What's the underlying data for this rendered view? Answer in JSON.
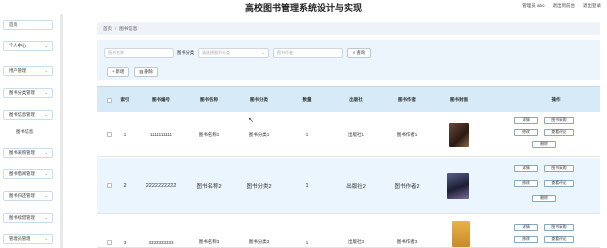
{
  "header": {
    "title": "高校图书管理系统设计与实现",
    "links": [
      "管理员 abo",
      "退出到前台",
      "退出登录"
    ]
  },
  "sidebar": {
    "items": [
      {
        "label": "首页",
        "expandable": false
      },
      {
        "label": "个人中心",
        "expandable": true
      },
      {
        "label": "用户管理",
        "expandable": true
      },
      {
        "label": "图书分类管理",
        "expandable": true
      },
      {
        "label": "图书信息管理",
        "expandable": true
      },
      {
        "label": "图书采购管理",
        "expandable": true
      },
      {
        "label": "图书借阅管理",
        "expandable": true
      },
      {
        "label": "图书归还管理",
        "expandable": true
      },
      {
        "label": "图书续借管理",
        "expandable": true
      },
      {
        "label": "管理员管理",
        "expandable": true
      }
    ],
    "sub_item": "图书信息"
  },
  "breadcrumb": {
    "home": "首页",
    "sep": "/",
    "current": "图书信息"
  },
  "search": {
    "name_placeholder": "图书名称",
    "category_label": "图书分类",
    "category_placeholder": "请选择图书分类",
    "author_placeholder": "图书作者",
    "search_button": "查询",
    "add_button": "+ 新增",
    "delete_button": "删除"
  },
  "table": {
    "headers": [
      "",
      "索引",
      "图书编号",
      "图书名称",
      "图书分类",
      "数量",
      "出版社",
      "图书作者",
      "图书封面",
      "操作"
    ],
    "rows": [
      {
        "index": "1",
        "code": "1111111111",
        "name": "图书名称1",
        "category": "图书分类1",
        "qty": "1",
        "publisher": "出版社1",
        "author": "图书作者1",
        "cover_color": "#3a2a22"
      },
      {
        "index": "2",
        "code": "2222222222",
        "name": "图书名称2",
        "category": "图书分类2",
        "qty": "1",
        "publisher": "出版社2",
        "author": "图书作者2",
        "cover_color": "#2a2d48"
      },
      {
        "index": "3",
        "code": "3333333333",
        "name": "图书名称3",
        "category": "图书分类3",
        "qty": "1",
        "publisher": "出版社3",
        "author": "图书作者3",
        "cover_color": "#d9a441"
      }
    ],
    "op_buttons": {
      "detail": "详情",
      "purchase": "图书采购",
      "edit": "修改",
      "review": "查看评论",
      "delete": "删除"
    }
  },
  "colors": {
    "header_bg": "#d6ebf7",
    "search_bg": "#edf5fc",
    "highlight_row": "#eaf5fd",
    "sidebar_border": "#c9ddea"
  },
  "icons": {
    "cursor": "mouse-cursor-icon",
    "chevron": "chevron-down-icon"
  }
}
